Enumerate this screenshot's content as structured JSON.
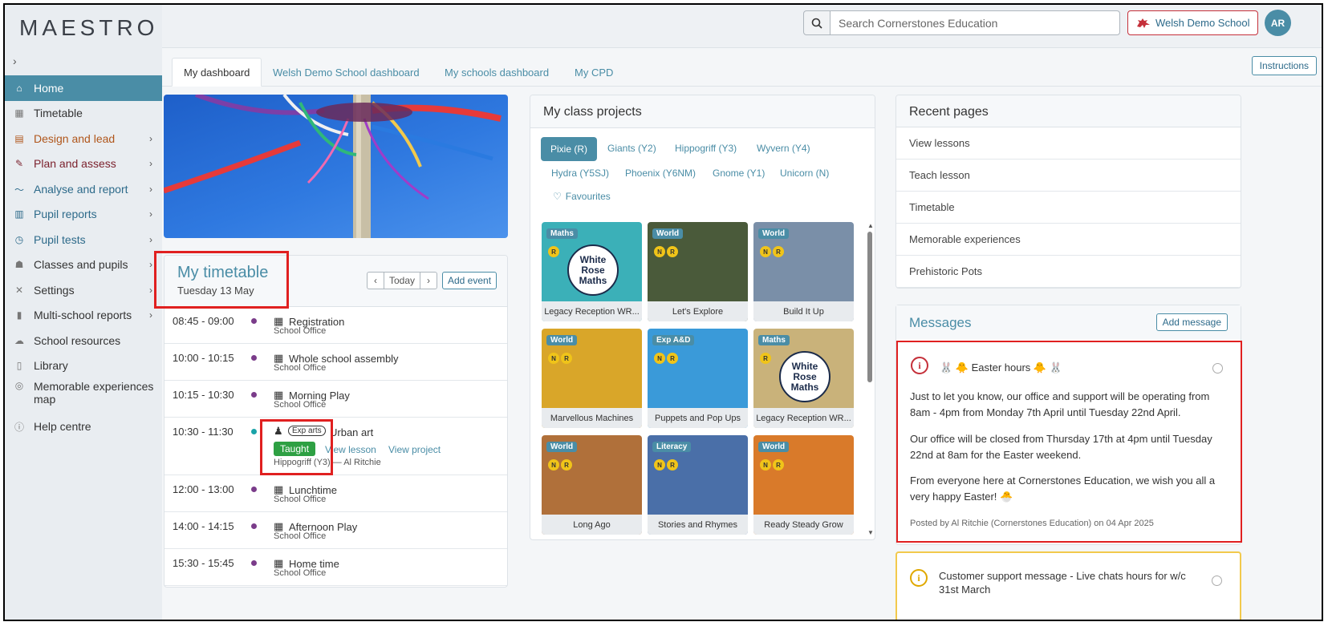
{
  "app": {
    "logo": "MAESTRO",
    "expand_icon": "›"
  },
  "sidebar": {
    "items": [
      {
        "label": "Home",
        "icon": "home-icon",
        "chevron": false,
        "color": "#ffffff"
      },
      {
        "label": "Timetable",
        "icon": "calendar-icon",
        "chevron": false,
        "color": "#333333"
      },
      {
        "label": "Design and lead",
        "icon": "design-icon",
        "chevron": true,
        "color": "#b0561b"
      },
      {
        "label": "Plan and assess",
        "icon": "pencil-icon",
        "chevron": true,
        "color": "#7a1f2b"
      },
      {
        "label": "Analyse and report",
        "icon": "chart-line-icon",
        "chevron": true,
        "color": "#2d6a8a"
      },
      {
        "label": "Pupil reports",
        "icon": "reports-icon",
        "chevron": true,
        "color": "#2d6a8a"
      },
      {
        "label": "Pupil tests",
        "icon": "stopwatch-icon",
        "chevron": true,
        "color": "#2d6a8a"
      },
      {
        "label": "Classes and pupils",
        "icon": "users-icon",
        "chevron": true,
        "color": "#333333"
      },
      {
        "label": "Settings",
        "icon": "tools-icon",
        "chevron": true,
        "color": "#333333"
      },
      {
        "label": "Multi-school reports",
        "icon": "bar-chart-icon",
        "chevron": true,
        "color": "#333333"
      },
      {
        "label": "School resources",
        "icon": "cloud-icon",
        "chevron": false,
        "color": "#333333"
      },
      {
        "label": "Library",
        "icon": "books-icon",
        "chevron": false,
        "color": "#333333"
      },
      {
        "label": "Memorable experiences map",
        "icon": "compass-icon",
        "chevron": false,
        "color": "#333333"
      },
      {
        "label": "Help centre",
        "icon": "info-icon",
        "chevron": false,
        "color": "#333333"
      }
    ]
  },
  "header": {
    "search_placeholder": "Search Cornerstones Education",
    "school_button": "Welsh Demo School",
    "avatar_initials": "AR"
  },
  "tabs": [
    "My dashboard",
    "Welsh Demo School dashboard",
    "My schools dashboard",
    "My CPD"
  ],
  "instructions_label": "Instructions",
  "timetable": {
    "title": "My timetable",
    "date": "Tuesday 13 May",
    "today_label": "Today",
    "add_event_label": "Add event",
    "entries": [
      {
        "time": "08:45 - 09:00",
        "name": "Registration",
        "sub": "School Office"
      },
      {
        "time": "10:00 - 10:15",
        "name": "Whole school assembly",
        "sub": "School Office"
      },
      {
        "time": "10:15 - 10:30",
        "name": "Morning Play",
        "sub": "School Office"
      },
      {
        "time": "10:30 - 11:30",
        "badge": "Exp arts",
        "name": "Urban art",
        "status": "Taught",
        "view_lesson": "View lesson",
        "view_project": "View project",
        "sub": "Hippogriff (Y3) — Al Ritchie"
      },
      {
        "time": "12:00 - 13:00",
        "name": "Lunchtime",
        "sub": "School Office"
      },
      {
        "time": "14:00 - 14:15",
        "name": "Afternoon Play",
        "sub": "School Office"
      },
      {
        "time": "15:30 - 15:45",
        "name": "Home time",
        "sub": "School Office"
      }
    ]
  },
  "projects": {
    "title": "My class projects",
    "class_tabs": [
      "Pixie (R)",
      "Giants (Y2)",
      "Hippogriff (Y3)",
      "Wyvern (Y4)",
      "Hydra (Y5SJ)",
      "Phoenix (Y6NM)",
      "Gnome (Y1)",
      "Unicorn (N)"
    ],
    "favourites_label": "Favourites",
    "cards": [
      {
        "tag": "Maths",
        "badges": [
          "R"
        ],
        "title": "Legacy Reception WR...",
        "bg": "#3bb0b8",
        "logo": [
          "White",
          "Rose",
          "Maths"
        ]
      },
      {
        "tag": "World",
        "badges": [
          "N",
          "R"
        ],
        "title": "Let's Explore",
        "bg": "#4a5a3a"
      },
      {
        "tag": "World",
        "badges": [
          "N",
          "R"
        ],
        "title": "Build It Up",
        "bg": "#7a8fa8"
      },
      {
        "tag": "World",
        "badges": [
          "N",
          "R"
        ],
        "title": "Marvellous Machines",
        "bg": "#d9a629"
      },
      {
        "tag": "Exp A&D",
        "badges": [
          "N",
          "R"
        ],
        "title": "Puppets and Pop Ups",
        "bg": "#3a9ad9"
      },
      {
        "tag": "Maths",
        "badges": [
          "R"
        ],
        "title": "Legacy Reception WR...",
        "bg": "#c9b27a",
        "logo": [
          "White",
          "Rose",
          "Maths"
        ]
      },
      {
        "tag": "World",
        "badges": [
          "N",
          "R"
        ],
        "title": "Long Ago",
        "bg": "#b0703a"
      },
      {
        "tag": "Literacy",
        "badges": [
          "N",
          "R"
        ],
        "title": "Stories and Rhymes",
        "bg": "#4a6fa8"
      },
      {
        "tag": "World",
        "badges": [
          "N",
          "R"
        ],
        "title": "Ready Steady Grow",
        "bg": "#d97a2a"
      }
    ]
  },
  "recent": {
    "title": "Recent pages",
    "items": [
      "View lessons",
      "Teach lesson",
      "Timetable",
      "Memorable experiences",
      "Prehistoric Pots"
    ]
  },
  "messages": {
    "title": "Messages",
    "add_label": "Add message",
    "items": [
      {
        "title": "🐰 🐥 Easter hours 🐥 🐰",
        "p1": "Just to let you know, our office and support will be operating from 8am - 4pm from Monday 7th April until Tuesday 22nd April.",
        "p2": "Our office will be closed from Thursday 17th at 4pm until Tuesday 22nd at 8am for the Easter weekend.",
        "p3": "From everyone here at Cornerstones Education, we wish you all a very happy Easter! 🐣",
        "posted": "Posted by Al Ritchie (Cornerstones Education) on 04 Apr 2025"
      },
      {
        "title": "Customer support message - Live chats hours for w/c 31st March"
      }
    ]
  }
}
